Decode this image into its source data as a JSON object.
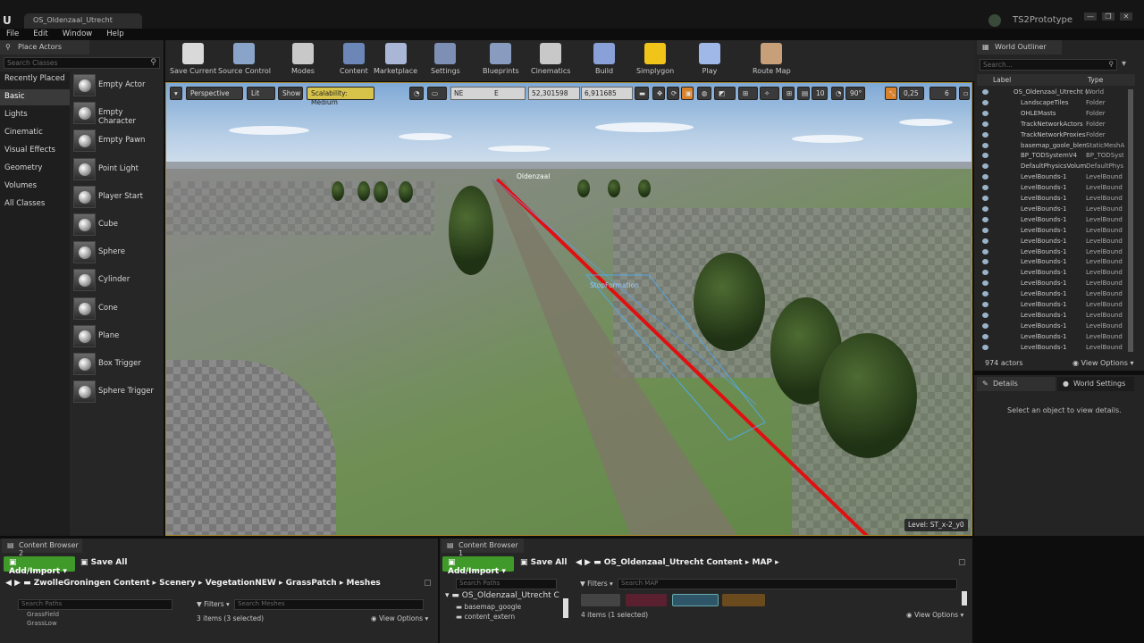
{
  "window": {
    "doc_tab": "OS_Oldenzaal_Utrecht",
    "project": "TS2Prototype",
    "controls": [
      "—",
      "❐",
      "✕"
    ]
  },
  "menu": [
    "File",
    "Edit",
    "Window",
    "Help"
  ],
  "place_actors": {
    "tab": "Place Actors",
    "search_placeholder": "Search Classes",
    "categories": [
      "Recently Placed",
      "Basic",
      "Lights",
      "Cinematic",
      "Visual Effects",
      "Geometry",
      "Volumes",
      "All Classes"
    ],
    "selected_category": "Basic",
    "items": [
      "Empty Actor",
      "Empty Character",
      "Empty Pawn",
      "Point Light",
      "Player Start",
      "Cube",
      "Sphere",
      "Cylinder",
      "Cone",
      "Plane",
      "Box Trigger",
      "Sphere Trigger"
    ]
  },
  "toolbar": [
    {
      "label": "Save Current",
      "icon": "save-icon",
      "color": "#d9d9d9"
    },
    {
      "label": "Source Control",
      "icon": "source-control-icon",
      "color": "#8aa3c9"
    },
    {
      "label": "Modes",
      "icon": "modes-icon",
      "color": "#c8c8c8"
    },
    {
      "label": "Content",
      "icon": "content-icon",
      "color": "#6c86b8"
    },
    {
      "label": "Marketplace",
      "icon": "marketplace-icon",
      "color": "#a9b6d6"
    },
    {
      "label": "Settings",
      "icon": "settings-icon",
      "color": "#7d8fb5"
    },
    {
      "label": "Blueprints",
      "icon": "blueprints-icon",
      "color": "#8a9bc0"
    },
    {
      "label": "Cinematics",
      "icon": "cinematics-icon",
      "color": "#c8c8c8"
    },
    {
      "label": "Build",
      "icon": "build-icon",
      "color": "#8aa0d8"
    },
    {
      "label": "Simplygon",
      "icon": "simplygon-icon",
      "color": "#f0c419"
    },
    {
      "label": "Play",
      "icon": "play-icon",
      "color": "#9fb8e8"
    },
    {
      "label": "Route Map",
      "icon": "route-map-icon",
      "color": "#c7a07a"
    }
  ],
  "viewport": {
    "perspective": "Perspective",
    "lit": "Lit",
    "show": "Show",
    "scalability": "Scalability: Medium",
    "compass": "NE",
    "compass_mark": "E",
    "lat": "52,301598",
    "lon": "6,911685",
    "grid_snap": "10",
    "rot_snap": "90°",
    "scale_snap": "0,25",
    "cam_speed": "6",
    "level": "Level:  ST_x-2_y0",
    "label_oldenzaal": "Oldenzaal",
    "label_stopform": "StopFormation",
    "accent_track": "#e01010"
  },
  "outliner": {
    "tab": "World Outliner",
    "search_placeholder": "Search...",
    "col_label": "Label",
    "col_type": "Type",
    "rows": [
      {
        "name": "OS_Oldenzaal_Utrecht (Ed",
        "type": "World"
      },
      {
        "name": "LandscapeTiles",
        "type": "Folder"
      },
      {
        "name": "OHLEMasts",
        "type": "Folder"
      },
      {
        "name": "TrackNetworkActors",
        "type": "Folder"
      },
      {
        "name": "TrackNetworkProxies",
        "type": "Folder"
      },
      {
        "name": "basemap_goole_blen",
        "type": "StaticMeshA"
      },
      {
        "name": "BP_TODSystemV4",
        "type": "BP_TODSyst"
      },
      {
        "name": "DefaultPhysicsVolume",
        "type": "DefaultPhys"
      },
      {
        "name": "LevelBounds-1",
        "type": "LevelBound"
      },
      {
        "name": "LevelBounds-1",
        "type": "LevelBound"
      },
      {
        "name": "LevelBounds-1",
        "type": "LevelBound"
      },
      {
        "name": "LevelBounds-1",
        "type": "LevelBound"
      },
      {
        "name": "LevelBounds-1",
        "type": "LevelBound"
      },
      {
        "name": "LevelBounds-1",
        "type": "LevelBound"
      },
      {
        "name": "LevelBounds-1",
        "type": "LevelBound"
      },
      {
        "name": "LevelBounds-1",
        "type": "LevelBound"
      },
      {
        "name": "LevelBounds-1",
        "type": "LevelBound"
      },
      {
        "name": "LevelBounds-1",
        "type": "LevelBound"
      },
      {
        "name": "LevelBounds-1",
        "type": "LevelBound"
      },
      {
        "name": "LevelBounds-1",
        "type": "LevelBound"
      },
      {
        "name": "LevelBounds-1",
        "type": "LevelBound"
      },
      {
        "name": "LevelBounds-1",
        "type": "LevelBound"
      },
      {
        "name": "LevelBounds-1",
        "type": "LevelBound"
      },
      {
        "name": "LevelBounds-1",
        "type": "LevelBound"
      },
      {
        "name": "LevelBounds-1",
        "type": "LevelBound"
      }
    ],
    "actor_count": "974 actors",
    "view_options": "View Options"
  },
  "details": {
    "tab": "Details",
    "world_settings_tab": "World Settings",
    "empty_msg": "Select an object to view details."
  },
  "cb2": {
    "tab": "Content Browser 2",
    "add_import": "Add/Import",
    "save_all": "Save All",
    "crumbs": [
      "ZwolleGroningen Content",
      "Scenery",
      "VegetationNEW",
      "GrassPatch",
      "Meshes"
    ],
    "search_paths": "Search Paths",
    "filters": "Filters",
    "search_meshes": "Search Meshes",
    "tree_items": [
      "GrassField",
      "GrassLow"
    ],
    "status": "3 items (3 selected)",
    "view_options": "View Options"
  },
  "cb1": {
    "tab": "Content Browser 1",
    "add_import": "Add/Import",
    "save_all": "Save All",
    "crumbs": [
      "OS_Oldenzaal_Utrecht Content",
      "MAP"
    ],
    "search_paths": "Search Paths",
    "filters": "Filters",
    "search_map": "Search MAP",
    "tree": [
      "OS_Oldenzaal_Utrecht C",
      "basemap_google",
      "content_extern"
    ],
    "status": "4 items (1 selected)",
    "view_options": "View Options"
  }
}
